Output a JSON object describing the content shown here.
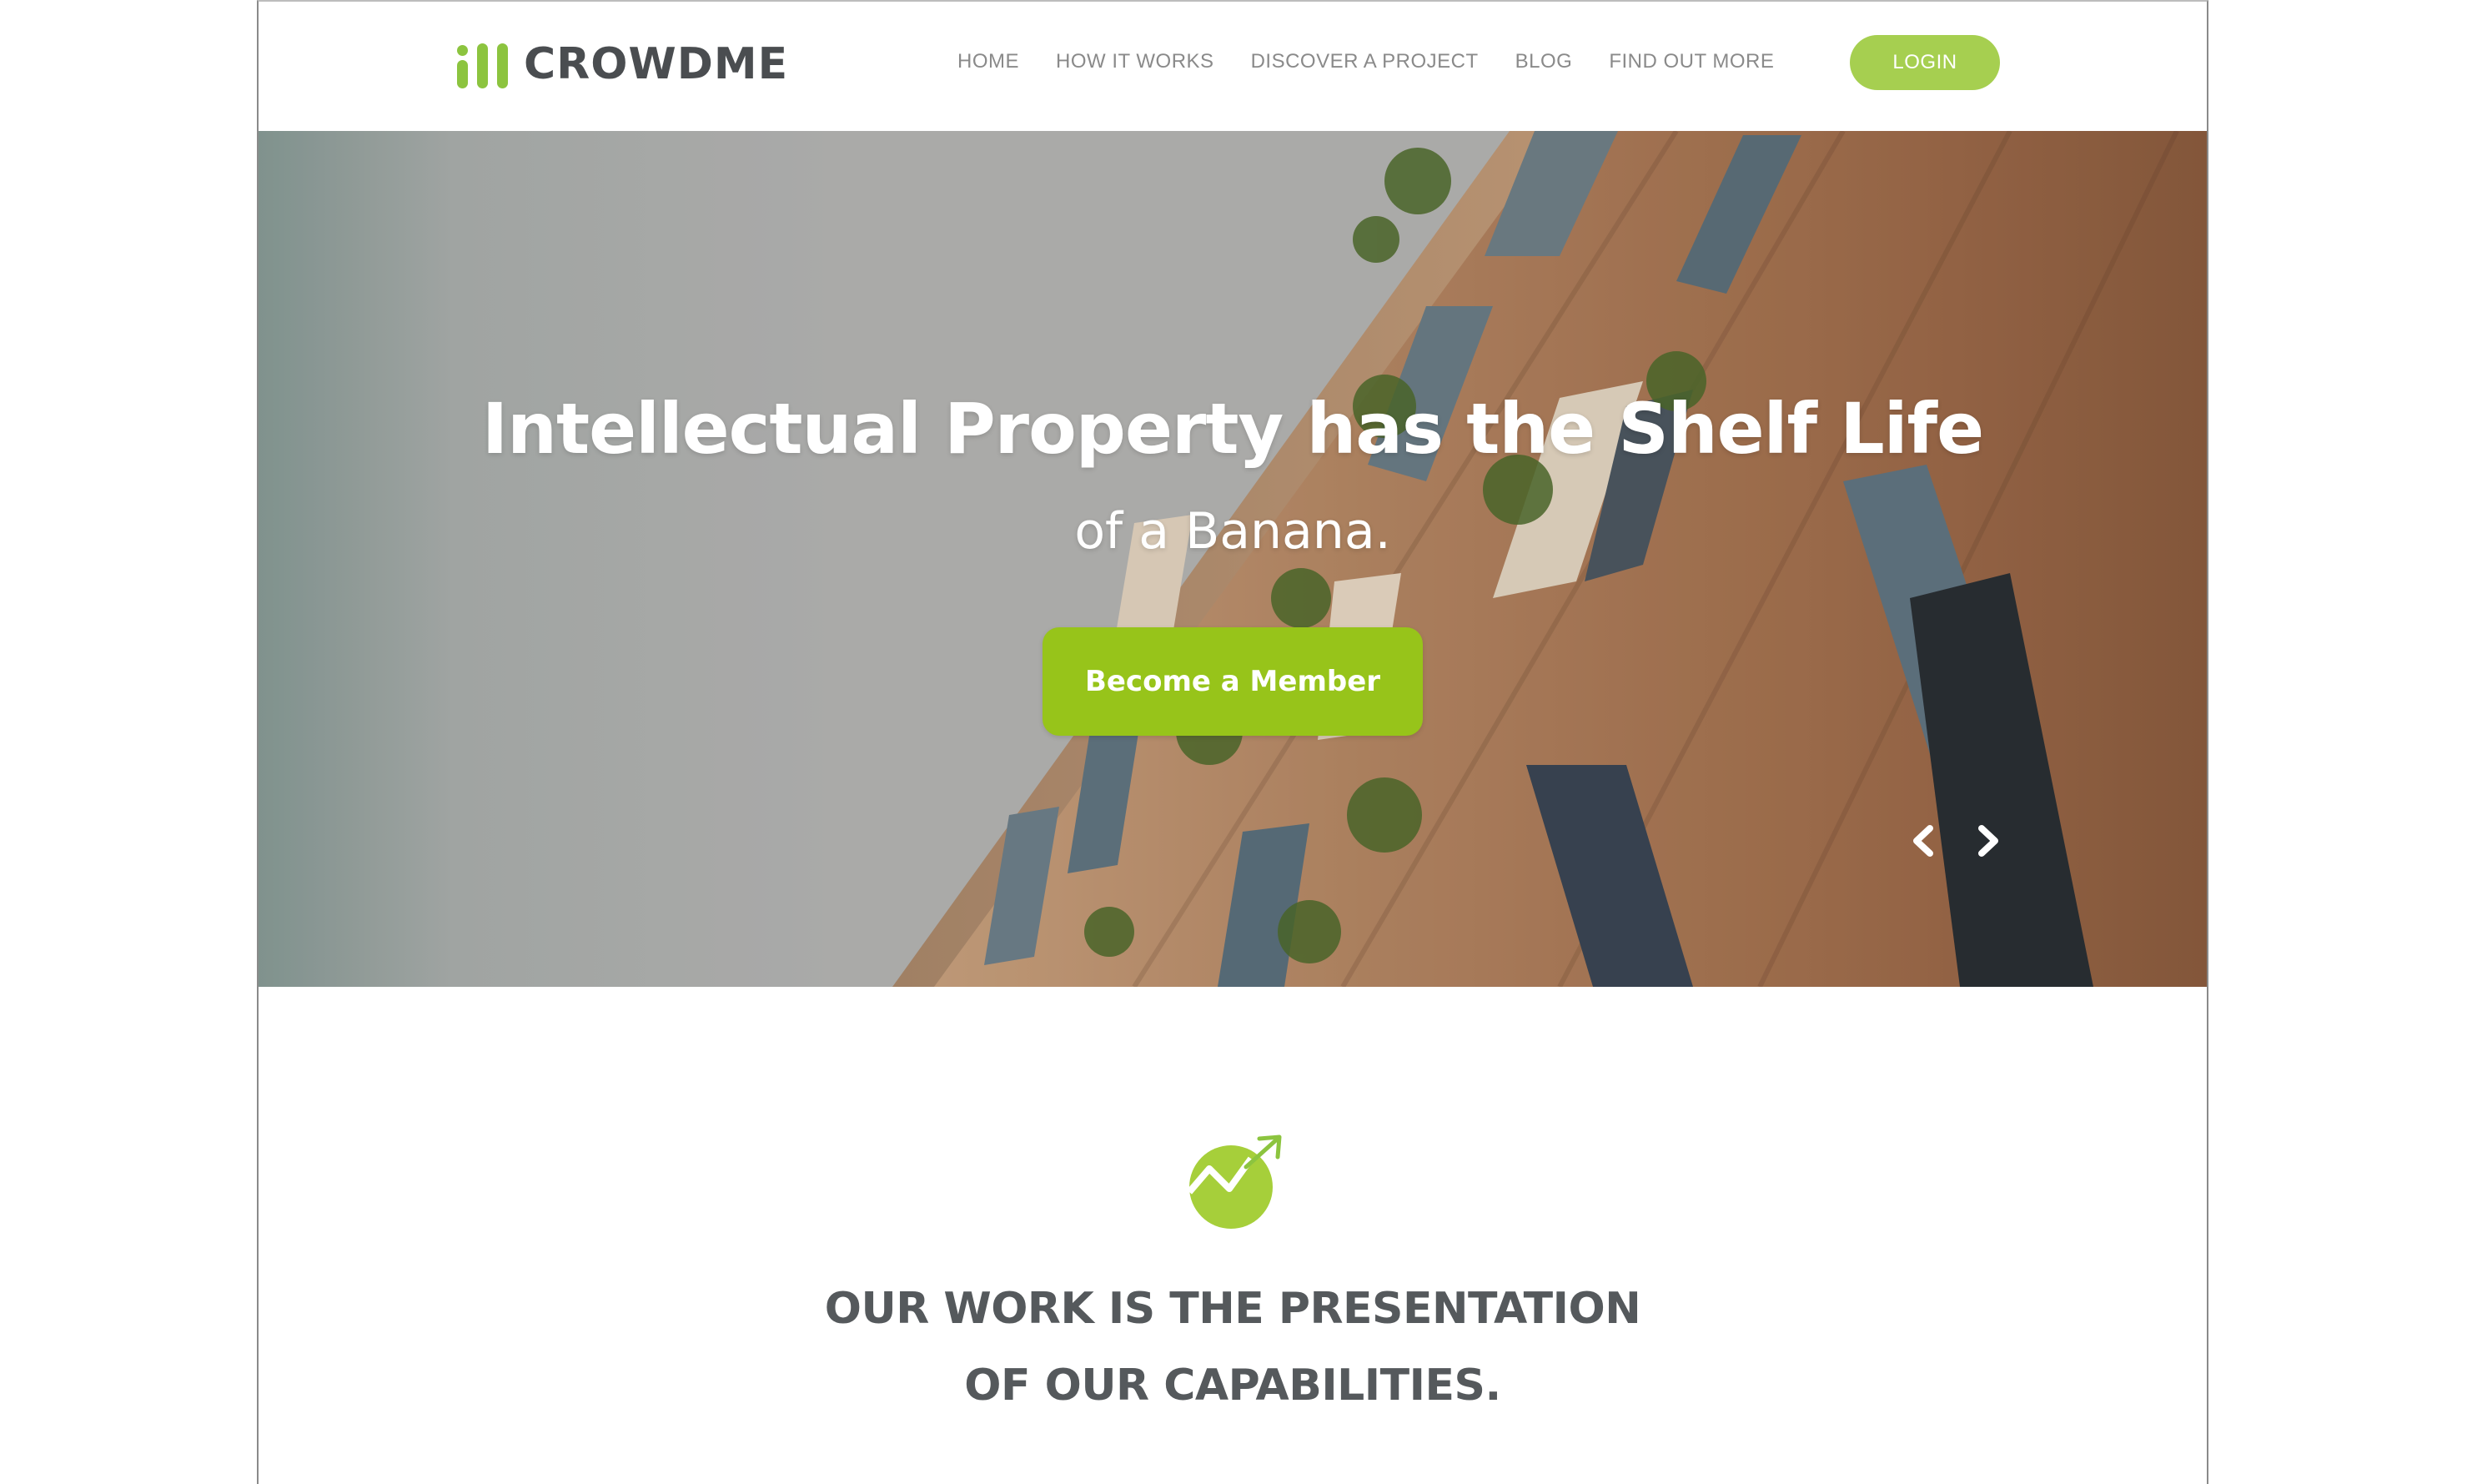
{
  "brand": {
    "name": "CROWDME",
    "accent_color": "#8cc43f",
    "cta_color": "#97c41a",
    "login_color": "#a6cf50",
    "text_dark": "#4a4d50"
  },
  "nav": {
    "items": [
      {
        "label": "HOME"
      },
      {
        "label": "HOW IT WORKS"
      },
      {
        "label": "DISCOVER A PROJECT"
      },
      {
        "label": "BLOG"
      },
      {
        "label": "FIND OUT MORE"
      }
    ],
    "login_label": "LOGIN"
  },
  "hero": {
    "title": "Intellectual Property has the Shelf Life",
    "subtitle": "of a Banana.",
    "cta_label": "Become a Member",
    "prev_icon": "chevron-left-icon",
    "next_icon": "chevron-right-icon"
  },
  "section": {
    "icon": "growth-chart-icon",
    "heading_line1": "OUR WORK IS THE PRESENTATION",
    "heading_line2": "OF OUR CAPABILITIES."
  }
}
